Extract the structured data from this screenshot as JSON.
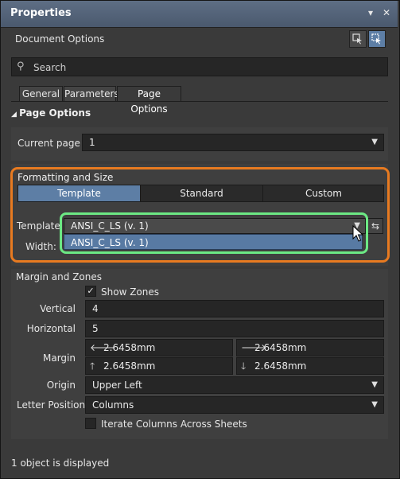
{
  "window": {
    "title": "Properties",
    "pin_icon": "▾",
    "close_icon": "✕"
  },
  "header": {
    "doc_options": "Document Options"
  },
  "search": {
    "placeholder": "Search"
  },
  "tabs": [
    {
      "label": "General"
    },
    {
      "label": "Parameters"
    },
    {
      "label": "Page Options",
      "active": true
    }
  ],
  "page_options": {
    "section_title": "Page Options",
    "current_page_label": "Current page",
    "current_page_value": "1"
  },
  "formatting": {
    "title": "Formatting and Size",
    "modes": [
      "Template",
      "Standard",
      "Custom"
    ],
    "selected_mode": "Template",
    "template_label": "Template",
    "template_value": "ANSI_C_LS (v. 1)",
    "dropdown_option": "ANSI_C_LS (v. 1)",
    "width_label": "Width:"
  },
  "margin_zones": {
    "title": "Margin and Zones",
    "show_zones_label": "Show Zones",
    "show_zones_checked": true,
    "vertical_label": "Vertical",
    "vertical_value": "4",
    "horizontal_label": "Horizontal",
    "horizontal_value": "5",
    "margin_label": "Margin",
    "margin_left": "2.6458mm",
    "margin_right": "2.6458mm",
    "margin_top": "2.6458mm",
    "margin_bottom": "2.6458mm",
    "origin_label": "Origin",
    "origin_value": "Upper Left",
    "letter_position_label": "Letter Position",
    "letter_position_value": "Columns",
    "iterate_label": "Iterate Columns Across Sheets",
    "iterate_checked": false
  },
  "status": {
    "text": "1 object is displayed"
  },
  "colors": {
    "accent": "#5d7ea5",
    "orange_highlight": "#e87a20",
    "green_highlight": "#6ce884"
  }
}
